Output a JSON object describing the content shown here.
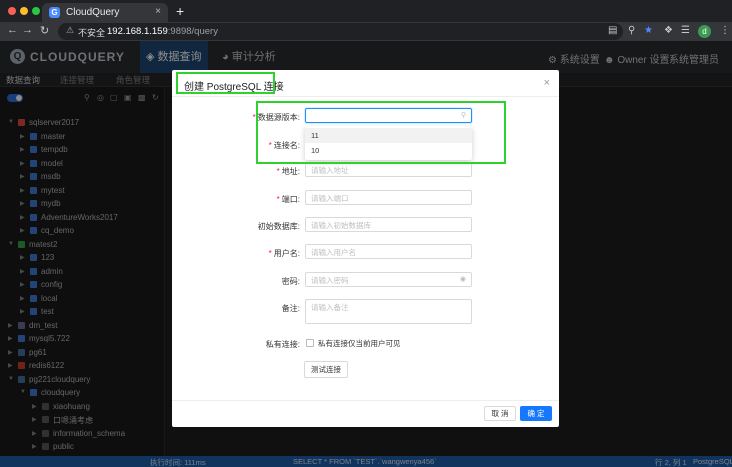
{
  "browser": {
    "tab_title": "CloudQuery",
    "tab_favicon": "G",
    "close_glyph": "×",
    "new_tab_glyph": "+",
    "insecure_label": "不安全",
    "url_host": "192.168.1.159",
    "url_path": ":9898/query",
    "avatar_letter": "d"
  },
  "app": {
    "logo_text": "CLOUDQUERY",
    "nav": {
      "query": "数据查询",
      "audit": "审计分析"
    },
    "header_right": {
      "system_settings": "系统设置",
      "owner_settings": "Owner 设置",
      "admin": "系统管理员"
    }
  },
  "subtabs": {
    "data_query": "数据查询",
    "connection_mgmt": "连接管理",
    "role_mgmt": "角色管理"
  },
  "tree": [
    {
      "label": "sqlserver2017",
      "level": 0,
      "color": "#e04b3c"
    },
    {
      "label": "master",
      "level": 1,
      "color": "#3f7fd6"
    },
    {
      "label": "tempdb",
      "level": 1,
      "color": "#3f7fd6"
    },
    {
      "label": "model",
      "level": 1,
      "color": "#3f7fd6"
    },
    {
      "label": "msdb",
      "level": 1,
      "color": "#3f7fd6"
    },
    {
      "label": "mytest",
      "level": 1,
      "color": "#3f7fd6"
    },
    {
      "label": "mydb",
      "level": 1,
      "color": "#3f7fd6"
    },
    {
      "label": "AdventureWorks2017",
      "level": 1,
      "color": "#3f7fd6"
    },
    {
      "label": "cq_demo",
      "level": 1,
      "color": "#3f7fd6"
    },
    {
      "label": "matest2",
      "level": 0,
      "color": "#3aa34a"
    },
    {
      "label": "123",
      "level": 1,
      "color": "#3f7fd6"
    },
    {
      "label": "admin",
      "level": 1,
      "color": "#3f7fd6"
    },
    {
      "label": "config",
      "level": 1,
      "color": "#3f7fd6"
    },
    {
      "label": "local",
      "level": 1,
      "color": "#3f7fd6"
    },
    {
      "label": "test",
      "level": 1,
      "color": "#3f7fd6"
    },
    {
      "label": "dm_test",
      "level": 0,
      "color": "#6a6a9a"
    },
    {
      "label": "mysql5.722",
      "level": 0,
      "color": "#3f7fd6"
    },
    {
      "label": "pg61",
      "level": 0,
      "color": "#4a6fa5"
    },
    {
      "label": "redis6122",
      "level": 0,
      "color": "#d23b2f"
    },
    {
      "label": "pg221cloudquery",
      "level": 0,
      "color": "#4a6fa5"
    },
    {
      "label": "cloudquery",
      "level": 1,
      "color": "#3f7fd6"
    },
    {
      "label": "xiaohuang",
      "level": 2,
      "color": "#5a5a5a"
    },
    {
      "label": "口嗯涌考虑",
      "level": 2,
      "color": "#5a5a5a"
    },
    {
      "label": "information_schema",
      "level": 2,
      "color": "#5a5a5a"
    },
    {
      "label": "public",
      "level": 2,
      "color": "#5a5a5a"
    }
  ],
  "status": {
    "exec_time": "执行时间:  111ms",
    "sql": "SELECT * FROM `TEST`.`wangwenya456`",
    "cursor": "行 2, 列 1",
    "dialect": "PostgreSQL"
  },
  "modal": {
    "title": "创建 PostgreSQL 连接",
    "close_glyph": "×",
    "fields": {
      "version": {
        "label": "数据源版本:",
        "value": ""
      },
      "conn_name": {
        "label": "连接名:"
      },
      "host": {
        "label": "地址:",
        "placeholder": "请输入地址"
      },
      "port": {
        "label": "端口:",
        "placeholder": "请输入端口"
      },
      "init_db": {
        "label": "初始数据库:",
        "placeholder": "请输入初始数据库"
      },
      "username": {
        "label": "用户名:",
        "placeholder": "请输入用户名"
      },
      "password": {
        "label": "密码:",
        "placeholder": "请输入密码"
      },
      "remark": {
        "label": "备注:",
        "placeholder": "请输入备注"
      },
      "private": {
        "label": "私有连接:",
        "checkbox_text": "私有连接仅当前用户可见"
      }
    },
    "version_options": [
      "11",
      "10"
    ],
    "buttons": {
      "test": "测试连接",
      "cancel": "取 消",
      "ok": "确 定"
    }
  }
}
